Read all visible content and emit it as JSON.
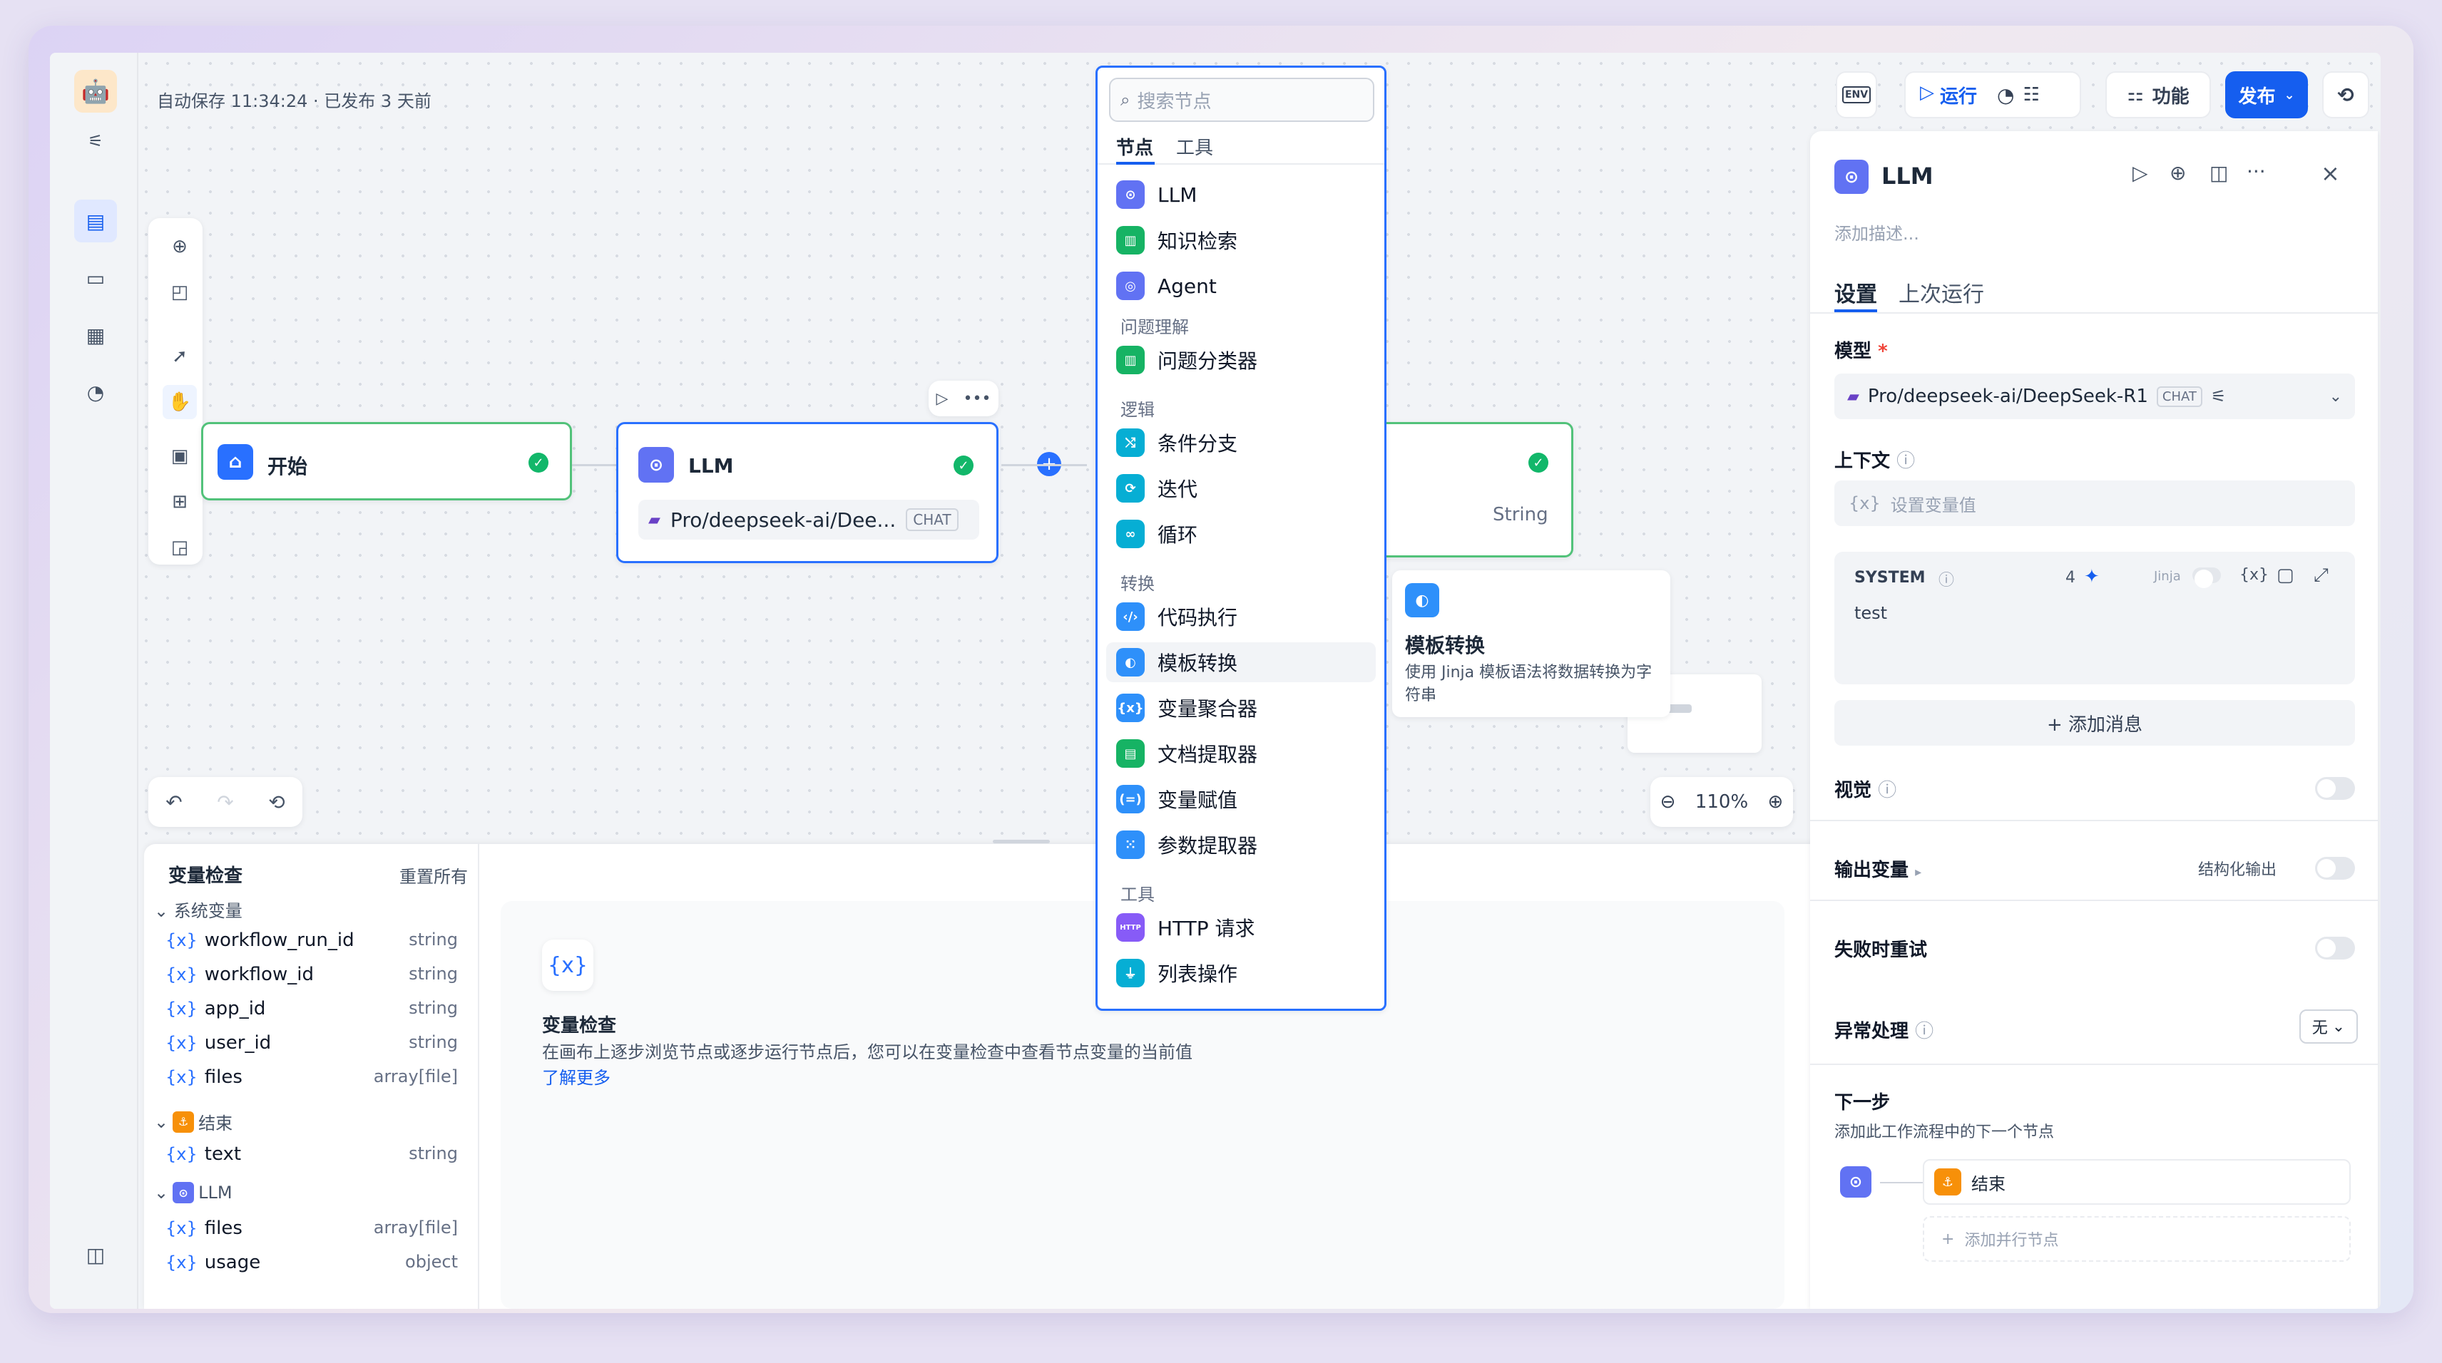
{
  "header": {
    "autosave": "自动保存 11:34:24 · 已发布 3 天前"
  },
  "toolbar": {
    "env": "ENV",
    "run": "运行",
    "features": "功能",
    "publish": "发布"
  },
  "canvas": {
    "start_node": {
      "title": "开始"
    },
    "llm_node": {
      "title": "LLM",
      "model": "Pro/deepseek-ai/Dee...",
      "model_badge": "CHAT"
    },
    "end_node": {
      "output_type": "String"
    },
    "zoom": "110%"
  },
  "node_menu": {
    "search_placeholder": "搜索节点",
    "tabs": [
      "节点",
      "工具"
    ],
    "items": {
      "llm": "LLM",
      "knowledge": "知识检索",
      "agent": "Agent",
      "cat_qu": "问题理解",
      "classifier": "问题分类器",
      "cat_logic": "逻辑",
      "ifelse": "条件分支",
      "iteration": "迭代",
      "loop": "循环",
      "cat_transform": "转换",
      "code": "代码执行",
      "template": "模板转换",
      "aggregator": "变量聚合器",
      "doc_extractor": "文档提取器",
      "assigner": "变量赋值",
      "param_extractor": "参数提取器",
      "cat_tools": "工具",
      "http": "HTTP 请求",
      "list_op": "列表操作"
    }
  },
  "tooltip": {
    "title": "模板转换",
    "desc": "使用 Jinja 模板语法将数据转换为字符串"
  },
  "var_inspect": {
    "title": "变量检查",
    "reset": "重置所有",
    "sys_group": "系统变量",
    "sys_vars": [
      {
        "name": "workflow_run_id",
        "type": "string"
      },
      {
        "name": "workflow_id",
        "type": "string"
      },
      {
        "name": "app_id",
        "type": "string"
      },
      {
        "name": "user_id",
        "type": "string"
      },
      {
        "name": "files",
        "type": "array[file]"
      }
    ],
    "end_group": "结束",
    "end_vars": [
      {
        "name": "text",
        "type": "string"
      }
    ],
    "llm_group": "LLM",
    "llm_vars": [
      {
        "name": "files",
        "type": "array[file]"
      },
      {
        "name": "usage",
        "type": "object"
      }
    ],
    "empty_title": "变量检查",
    "empty_desc": "在画布上逐步浏览节点或逐步运行节点后，您可以在变量检查中查看节点变量的当前值",
    "learn_more": "了解更多"
  },
  "panel": {
    "title": "LLM",
    "desc_placeholder": "添加描述...",
    "tabs": [
      "设置",
      "上次运行"
    ],
    "model_label": "模型",
    "model": "Pro/deepseek-ai/DeepSeek-R1",
    "model_badge": "CHAT",
    "context_label": "上下文",
    "context_placeholder": "设置变量值",
    "system_label": "SYSTEM",
    "system_count": "4",
    "jinja": "Jinja",
    "system_text": "test",
    "add_message": "+ 添加消息",
    "vision": "视觉",
    "output_vars": "输出变量",
    "structured_output": "结构化输出",
    "retry": "失败时重试",
    "error_handling": "异常处理",
    "error_value": "无",
    "next_step": "下一步",
    "next_desc": "添加此工作流程中的下一个节点",
    "next_node": "结束",
    "add_parallel": "添加并行节点"
  }
}
